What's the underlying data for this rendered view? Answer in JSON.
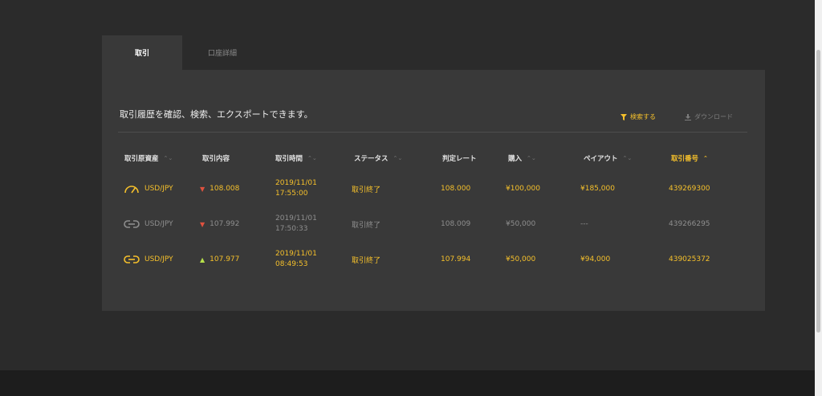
{
  "tabs": [
    {
      "label": "取引",
      "active": true
    },
    {
      "label": "口座詳細",
      "active": false
    }
  ],
  "description": "取引履歴を確認、検索、エクスポートできます。",
  "actions": {
    "search_label": "検索する",
    "download_label": "ダウンロード"
  },
  "columns": [
    "取引原資産",
    "取引内容",
    "取引時間",
    "ステータス",
    "判定レート",
    "購入",
    "ペイアウト",
    "取引番号"
  ],
  "rows": [
    {
      "asset": "USD/JPY",
      "asset_icon": "gauge-icon",
      "direction": "down",
      "direction_icon": "arrow-down-icon",
      "rate": "108.008",
      "date": "2019/11/01",
      "time": "17:55:00",
      "status": "取引終了",
      "judge_rate": "108.000",
      "purchase": "¥100,000",
      "payout": "¥185,000",
      "trade_no": "439269300",
      "active": true
    },
    {
      "asset": "USD/JPY",
      "asset_icon": "link-icon",
      "direction": "down",
      "direction_icon": "arrow-down-icon",
      "rate": "107.992",
      "date": "2019/11/01",
      "time": "17:50:33",
      "status": "取引終了",
      "judge_rate": "108.009",
      "purchase": "¥50,000",
      "payout": "---",
      "trade_no": "439266295",
      "active": false
    },
    {
      "asset": "USD/JPY",
      "asset_icon": "link-icon",
      "direction": "up",
      "direction_icon": "arrow-up-icon",
      "rate": "107.977",
      "date": "2019/11/01",
      "time": "08:49:53",
      "status": "取引終了",
      "judge_rate": "107.994",
      "purchase": "¥50,000",
      "payout": "¥94,000",
      "trade_no": "439025372",
      "active": true
    }
  ],
  "colors": {
    "accent": "#f5c02b",
    "down": "#e0523f",
    "up": "#b6e04a",
    "panel": "#393939",
    "background": "#2b2b2b"
  }
}
